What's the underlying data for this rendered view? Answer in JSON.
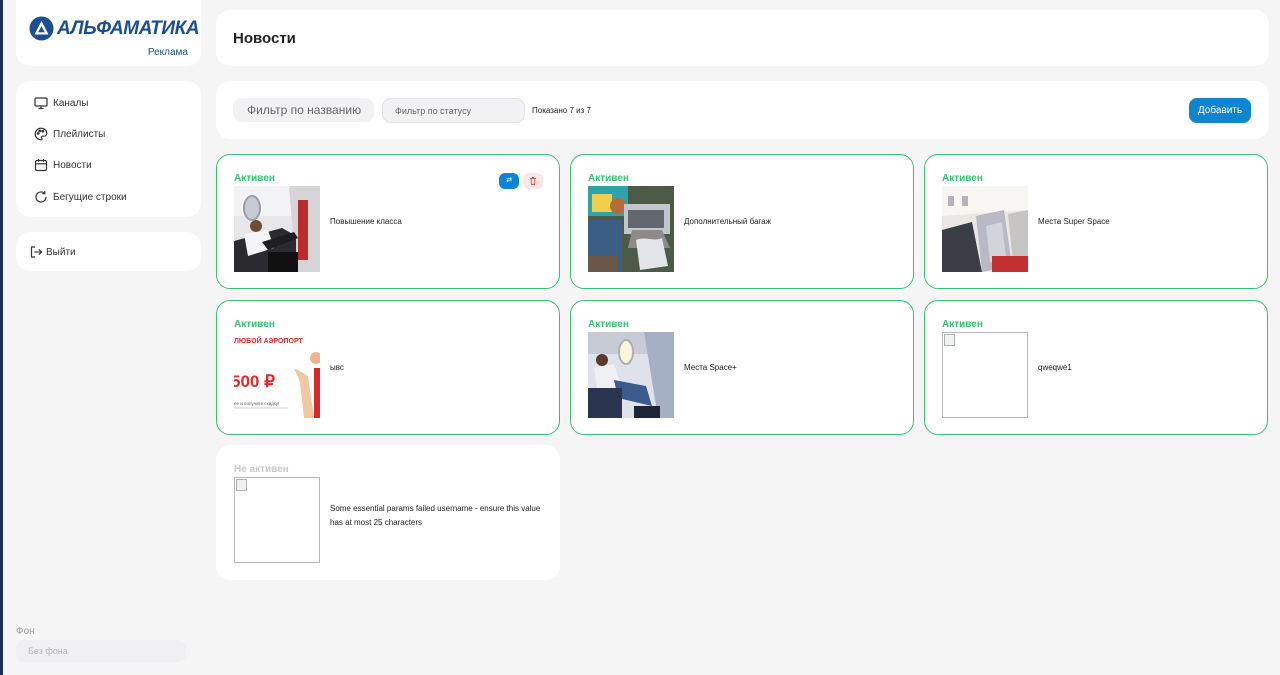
{
  "sidebar": {
    "logo": {
      "name": "АЛЬФАМАТИКА",
      "subtitle": "Реклама"
    },
    "nav": [
      {
        "label": "Каналы",
        "icon": "monitor-icon"
      },
      {
        "label": "Плейлисты",
        "icon": "palette-icon"
      },
      {
        "label": "Новости",
        "icon": "calendar-icon"
      },
      {
        "label": "Бегущие строки",
        "icon": "refresh-icon"
      }
    ],
    "logout_label": "Выйти",
    "background": {
      "label": "Фон",
      "value": "Без фона"
    }
  },
  "header": {
    "title": "Новости"
  },
  "filters": {
    "name_placeholder": "Фильтр по названию",
    "status_placeholder": "Фильтр по статусу",
    "shown": "Показано 7 из 7",
    "add_label": "Добавить"
  },
  "accent_colors": {
    "primary": "#0f84cf",
    "active": "#39c173",
    "inactive": "#c9c9c9"
  },
  "news": [
    {
      "status": "Активен",
      "title": "Повышение класса",
      "image": "plane-cabin-man-photo",
      "active": true
    },
    {
      "status": "Активен",
      "title": "Дополнительный багаж",
      "image": "laptop-luggage-photo",
      "active": true
    },
    {
      "status": "Активен",
      "title": "Места Super Space",
      "image": "business-seat-photo",
      "active": true
    },
    {
      "status": "Активен",
      "title": "ывс",
      "image": "airport-promo-banner",
      "active": true,
      "banner": {
        "line1": "ЛЮБОЙ АЭРОПОРТ",
        "price": "500 ₽",
        "line2": "ее и получите скидку!"
      }
    },
    {
      "status": "Активен",
      "title": "Места Space+",
      "image": "window-seat-woman-photo",
      "active": true
    },
    {
      "status": "Активен",
      "title": "qweqwe1",
      "image": "broken-image",
      "active": true
    },
    {
      "status": "Не активен",
      "title": "Some essential params failed username - ensure this value has at most 25 characters",
      "image": "broken-image",
      "active": false
    }
  ],
  "card_actions": {
    "edit_glyph": "⇄"
  }
}
